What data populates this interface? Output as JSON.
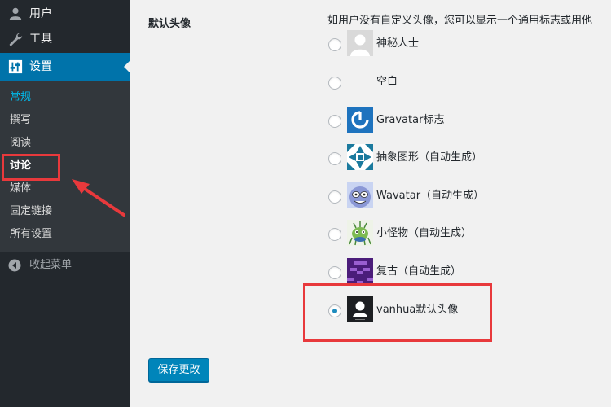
{
  "sidebar": {
    "menu": [
      {
        "label": "用户",
        "icon": "user-icon"
      },
      {
        "label": "工具",
        "icon": "wrench-icon"
      },
      {
        "label": "设置",
        "icon": "settings-sliders-icon",
        "active": true
      }
    ],
    "submenu": [
      {
        "label": "常规",
        "current": true
      },
      {
        "label": "撰写"
      },
      {
        "label": "阅读"
      },
      {
        "label": "讨论",
        "bold": true
      },
      {
        "label": "媒体"
      },
      {
        "label": "固定链接"
      },
      {
        "label": "所有设置"
      }
    ],
    "collapse_label": "收起菜单"
  },
  "main": {
    "field_label": "默认头像",
    "description": "如用户没有自定义头像，您可以显示一个通用标志或用他",
    "options": [
      {
        "label": "神秘人士",
        "avatar": "mystery-person"
      },
      {
        "label": "空白",
        "avatar": "blank"
      },
      {
        "label": "Gravatar标志",
        "avatar": "gravatar-logo"
      },
      {
        "label": "抽象图形（自动生成）",
        "avatar": "identicon"
      },
      {
        "label": "Wavatar（自动生成）",
        "avatar": "wavatar"
      },
      {
        "label": "小怪物（自动生成）",
        "avatar": "monsterid"
      },
      {
        "label": "复古（自动生成）",
        "avatar": "retro"
      },
      {
        "label": "vanhua默认头像",
        "avatar": "custom-default",
        "selected": true
      }
    ],
    "save_label": "保存更改"
  },
  "colors": {
    "sidebar_bg": "#23282d",
    "submenu_bg": "#32373c",
    "active_menu": "#0073aa",
    "current_submenu": "#00b9eb",
    "button": "#0085ba",
    "annotation": "#e8393c"
  }
}
